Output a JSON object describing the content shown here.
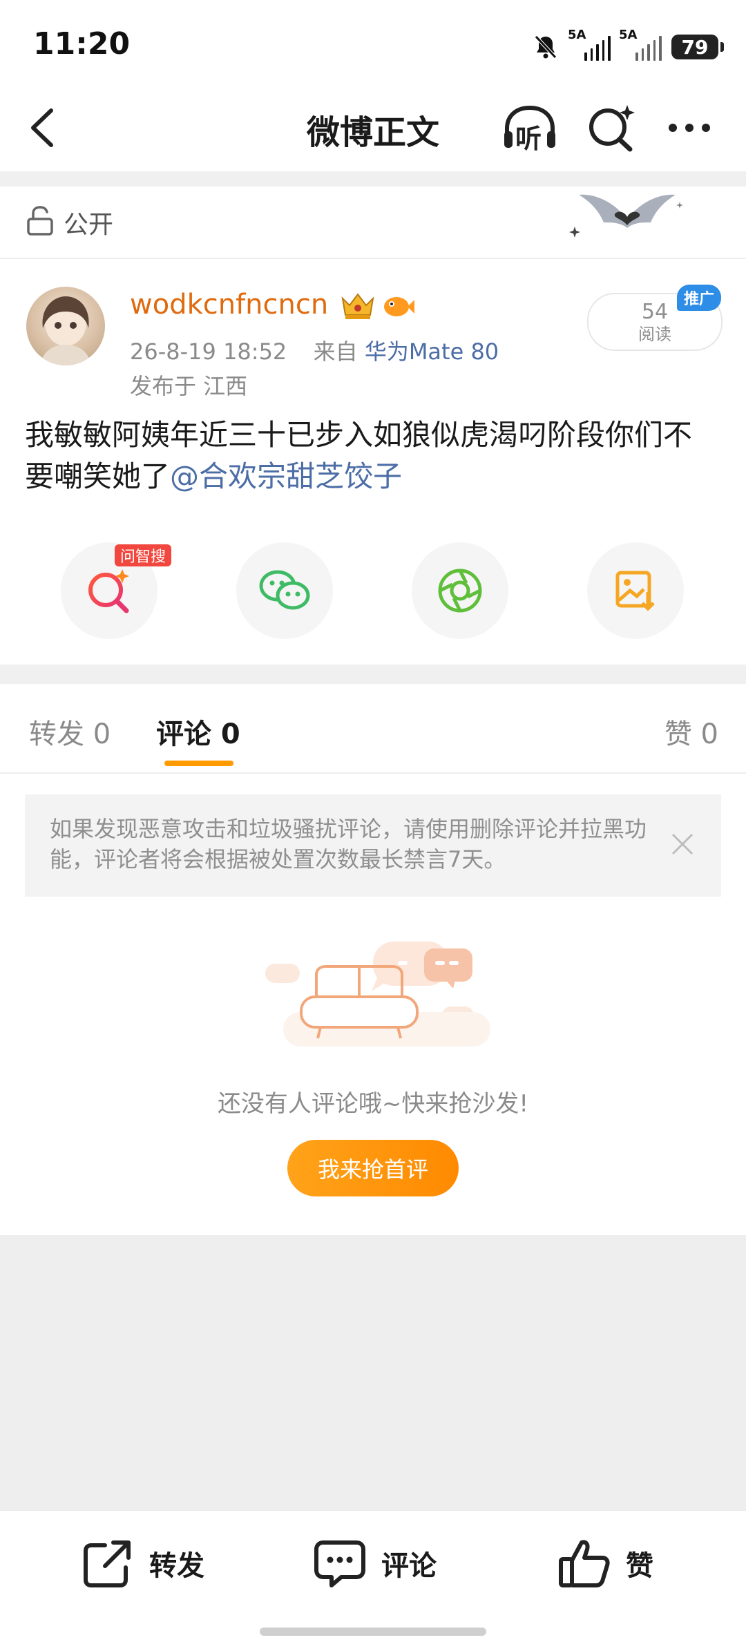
{
  "status_bar": {
    "time": "11:20",
    "signal1_label": "5A",
    "signal2_label": "5A",
    "battery": "79",
    "icons": [
      "mute-bell-icon",
      "signal-icon",
      "signal-icon",
      "battery-icon"
    ]
  },
  "header": {
    "title": "微博正文",
    "listen_label": "听",
    "icons": [
      "back-icon",
      "listen-icon",
      "ai-search-icon",
      "more-icon"
    ]
  },
  "visibility": {
    "label": "公开"
  },
  "post": {
    "username": "wodkcnfncncn",
    "time": "26-8-19 18:52",
    "from_prefix": "来自",
    "device": "华为Mate 80",
    "location": "发布于 江西",
    "read_count": "54",
    "read_label": "阅读",
    "promo_tag": "推广",
    "body_text": "我敏敏阿姨年近三十已步入如狼似虎渴叼阶段你们不要嘲笑她了",
    "mention": "@合欢宗甜芝饺子"
  },
  "share": {
    "ai_search_tag": "问智搜",
    "items": [
      "ai-search",
      "wechat",
      "moments",
      "save-image"
    ]
  },
  "tabs": {
    "repost": "转发 0",
    "comment": "评论 0",
    "like": "赞 0",
    "active": "comment"
  },
  "notice": {
    "text": "如果发现恶意攻击和垃圾骚扰评论，请使用删除评论并拉黑功能，评论者将会根据被处置次数最长禁言7天。"
  },
  "empty_state": {
    "text": "还没有人评论哦~快来抢沙发!",
    "button": "我来抢首评"
  },
  "bottom_bar": {
    "repost": "转发",
    "comment": "评论",
    "like": "赞"
  },
  "colors": {
    "accent": "#ff9a00",
    "username": "#e06a0e",
    "link": "#4c6da6",
    "promo": "#2e8de6"
  }
}
